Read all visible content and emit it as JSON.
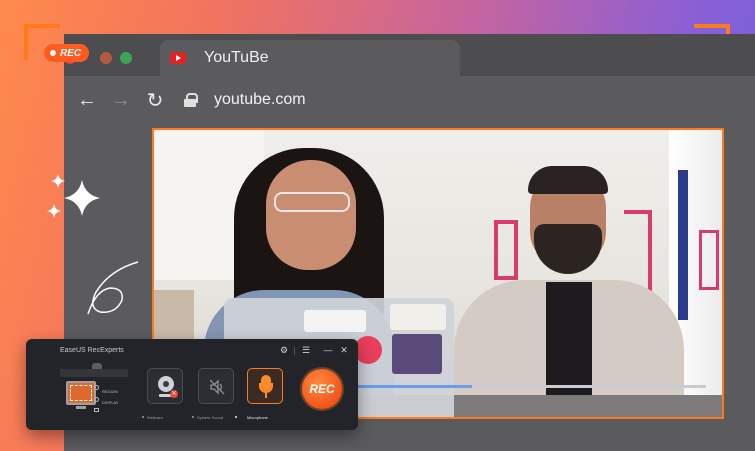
{
  "badge": {
    "rec_label": "REC"
  },
  "browser": {
    "tab_title": "YouTuBe",
    "url": "youtube.com",
    "icons": {
      "back": "back-arrow-icon",
      "forward": "forward-arrow-icon",
      "reload": "reload-icon",
      "lock": "lock-icon",
      "favicon": "youtube-favicon-icon"
    }
  },
  "video": {
    "progress": 0.37
  },
  "recorder": {
    "title": "EaseUS RecExperts",
    "source_options": [
      "REGION",
      "DISPLAY"
    ],
    "devices": [
      {
        "label": "Webcam",
        "state": "off"
      },
      {
        "label": "System Sound",
        "state": "muted"
      },
      {
        "label": "Microphone",
        "state": "active"
      }
    ],
    "rec_button": "REC"
  },
  "colors": {
    "accent": "#ff7a1a",
    "rec": "#f2541c"
  }
}
